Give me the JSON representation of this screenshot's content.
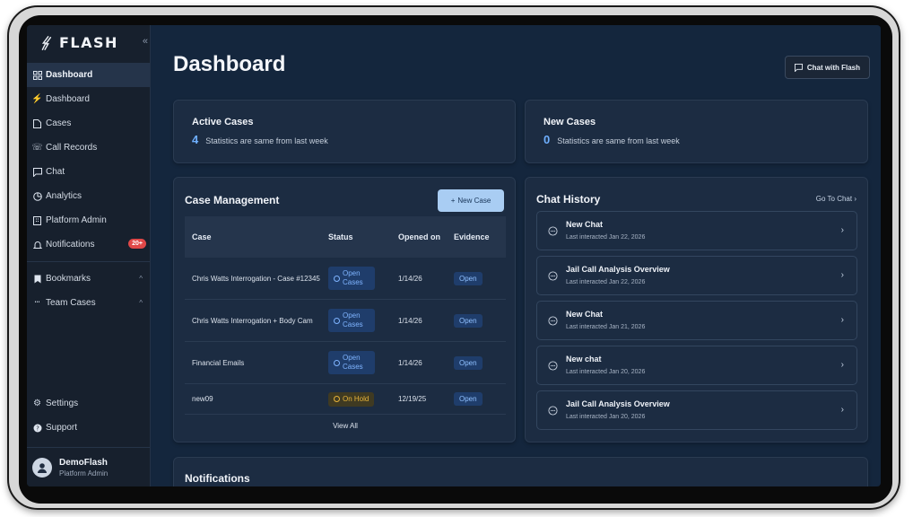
{
  "app": {
    "logo_text": "FLASH"
  },
  "sidebar": {
    "items": [
      {
        "label": "Dashboard",
        "icon": "grid-icon",
        "active": true
      },
      {
        "label": "Dashboard",
        "icon": "bolt-icon"
      },
      {
        "label": "Cases",
        "icon": "file-icon"
      },
      {
        "label": "Call Records",
        "icon": "phone-icon"
      },
      {
        "label": "Chat",
        "icon": "chat-icon"
      },
      {
        "label": "Analytics",
        "icon": "pie-chart-icon"
      },
      {
        "label": "Platform Admin",
        "icon": "building-icon"
      },
      {
        "label": "Notifications",
        "icon": "bell-icon",
        "badge": "20+"
      }
    ],
    "groups": [
      {
        "label": "Bookmarks",
        "icon": "bookmark-icon"
      },
      {
        "label": "Team Cases",
        "icon": "team-icon"
      }
    ],
    "bottom": [
      {
        "label": "Settings",
        "icon": "gear-icon"
      },
      {
        "label": "Support",
        "icon": "help-icon"
      }
    ],
    "user": {
      "name": "DemoFlash",
      "role": "Platform Admin"
    }
  },
  "header": {
    "title": "Dashboard",
    "chat_button": "Chat with Flash"
  },
  "stats": {
    "active": {
      "title": "Active Cases",
      "value": "4",
      "note": "Statistics are same from last week"
    },
    "new": {
      "title": "New Cases",
      "value": "0",
      "note": "Statistics are same from last week"
    }
  },
  "case_management": {
    "title": "Case Management",
    "new_button": "New Case",
    "columns": [
      "Case",
      "Status",
      "Opened on",
      "Evidence"
    ],
    "rows": [
      {
        "case": "Chris Watts Interrogation - Case #12345",
        "status": "Open Cases",
        "opened": "1/14/26",
        "evidence": "Open"
      },
      {
        "case": "Chris Watts Interrogation + Body Cam",
        "status": "Open Cases",
        "opened": "1/14/26",
        "evidence": "Open"
      },
      {
        "case": "Financial Emails",
        "status": "Open Cases",
        "opened": "1/14/26",
        "evidence": "Open"
      },
      {
        "case": "new09",
        "status": "On Hold",
        "opened": "12/19/25",
        "evidence": "Open"
      }
    ],
    "view_all": "View All"
  },
  "chat_history": {
    "title": "Chat History",
    "go_to": "Go To Chat",
    "items": [
      {
        "title": "New Chat",
        "sub": "Last interacted Jan 22, 2026"
      },
      {
        "title": "Jail Call Analysis Overview",
        "sub": "Last interacted Jan 22, 2026"
      },
      {
        "title": "New Chat",
        "sub": "Last interacted Jan 21, 2026"
      },
      {
        "title": "New chat",
        "sub": "Last interacted Jan 20, 2026"
      },
      {
        "title": "Jail Call Analysis Overview",
        "sub": "Last interacted Jan 20, 2026"
      }
    ]
  },
  "notifications": {
    "title": "Notifications"
  },
  "colors": {
    "accent": "#6fb0ff",
    "badge": "#e04848",
    "hold": "#e8b43a"
  }
}
